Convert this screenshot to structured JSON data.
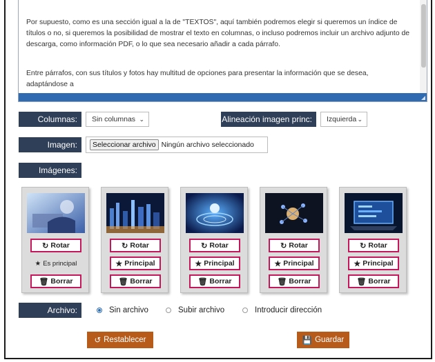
{
  "editor": {
    "paragraph_1": "Por supuesto, como es una sección igual a la de \"TEXTOS\", aquí también podremos elegir si queremos un índice de títulos o no, si queremos la posibilidad de mostrar el texto en columnas, o incluso podremos incluir un archivo adjunto de descarga, como información PDF, o lo que sea necesario añadir a cada párrafo.",
    "paragraph_2": "Entre párrafos, con sus títulos y fotos hay multitud de opciones para presentar la información que se desea, adaptándose a"
  },
  "columns": {
    "label": "Columnas:",
    "selected": "Sin columnas"
  },
  "alignment": {
    "label": "Alineación imagen princ:",
    "selected": "Izquierda"
  },
  "image": {
    "label": "Imagen:",
    "button": "Seleccionar archivo",
    "status": "Ningún archivo seleccionado"
  },
  "images": {
    "label": "Imágenes:",
    "cards": [
      {
        "rotate": "Rotar",
        "principal": "Es principal",
        "is_principal": true,
        "delete": "Borrar"
      },
      {
        "rotate": "Rotar",
        "principal": "Principal",
        "is_principal": false,
        "delete": "Borrar"
      },
      {
        "rotate": "Rotar",
        "principal": "Principal",
        "is_principal": false,
        "delete": "Borrar"
      },
      {
        "rotate": "Rotar",
        "principal": "Principal",
        "is_principal": false,
        "delete": "Borrar"
      },
      {
        "rotate": "Rotar",
        "principal": "Principal",
        "is_principal": false,
        "delete": "Borrar"
      }
    ]
  },
  "attachment": {
    "label": "Archivo:",
    "options": [
      {
        "label": "Sin archivo",
        "selected": true
      },
      {
        "label": "Subir archivo",
        "selected": false
      },
      {
        "label": "Introducir dirección",
        "selected": false
      }
    ]
  },
  "actions": {
    "reset": "Restablecer",
    "save": "Guardar"
  },
  "colors": {
    "label_bg": "#2f3f57",
    "accent": "#2f6bb0",
    "button_border": "#c2185b",
    "action_bg": "#b65b1a"
  },
  "icons": {
    "rotate": "rotate-icon",
    "principal": "star-icon",
    "delete": "trash-icon",
    "reset": "undo-icon",
    "save": "save-icon"
  }
}
